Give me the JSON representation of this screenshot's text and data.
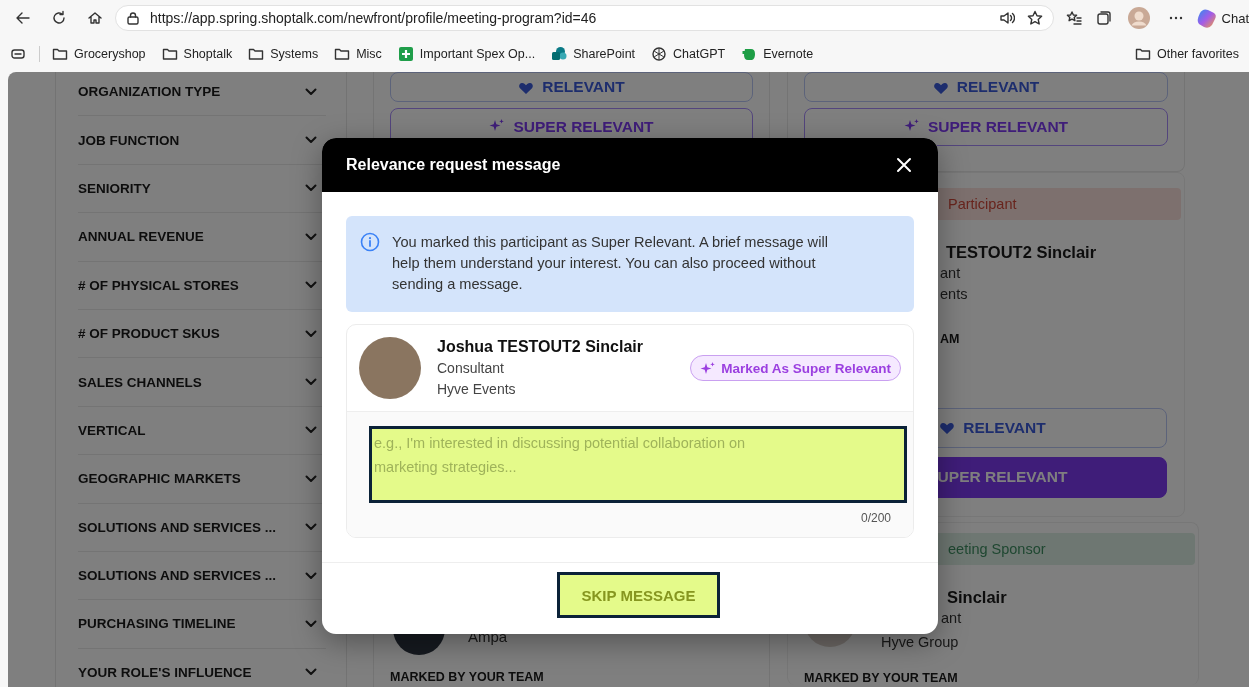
{
  "browser": {
    "url": "https://app.spring.shoptalk.com/newfront/profile/meeting-program?id=46",
    "chat_label": "Chat",
    "bookmarks": [
      {
        "label": "Groceryshop",
        "kind": "folder"
      },
      {
        "label": "Shoptalk",
        "kind": "folder"
      },
      {
        "label": "Systems",
        "kind": "folder"
      },
      {
        "label": "Misc",
        "kind": "folder"
      },
      {
        "label": "Important Spex Op...",
        "kind": "plus"
      },
      {
        "label": "SharePoint",
        "kind": "share"
      },
      {
        "label": "ChatGPT",
        "kind": "knot"
      },
      {
        "label": "Evernote",
        "kind": "note"
      }
    ],
    "other_favorites": "Other favorites"
  },
  "filters": [
    {
      "label": "ORGANIZATION TYPE"
    },
    {
      "label": "JOB FUNCTION"
    },
    {
      "label": "SENIORITY"
    },
    {
      "label": "ANNUAL REVENUE"
    },
    {
      "label": "# OF PHYSICAL STORES"
    },
    {
      "label": "# OF PRODUCT SKUS"
    },
    {
      "label": "SALES CHANNELS"
    },
    {
      "label": "VERTICAL"
    },
    {
      "label": "GEOGRAPHIC MARKETS"
    },
    {
      "label": "SOLUTIONS AND SERVICES ..."
    },
    {
      "label": "SOLUTIONS AND SERVICES ..."
    },
    {
      "label": "PURCHASING TIMELINE"
    },
    {
      "label": "YOUR ROLE'S INFLUENCE"
    }
  ],
  "middle_column": {
    "actions": [
      {
        "kind": "relevant",
        "label": "RELEVANT",
        "selected": false,
        "show_icon": true
      },
      {
        "kind": "super",
        "label": "SUPER RELEVANT",
        "selected": false,
        "show_icon": true
      }
    ],
    "company": "Ampa",
    "marked_by": "MARKED BY YOUR TEAM"
  },
  "right_column": {
    "actions": [
      {
        "kind": "relevant",
        "label": "RELEVANT",
        "selected": false,
        "show_icon": true
      },
      {
        "kind": "super",
        "label": "SUPER RELEVANT",
        "selected": false,
        "show_icon": true
      }
    ],
    "card": {
      "tag": {
        "kind": "participant",
        "label": "Participant"
      },
      "name": "TESTOUT2 Sinclair",
      "role": "ant",
      "company": "ents",
      "team_label": "AM",
      "actions": [
        {
          "kind": "relevant",
          "label": "RELEVANT",
          "selected": false,
          "show_icon": true
        },
        {
          "kind": "super",
          "label": "UPER RELEVANT",
          "selected": true,
          "show_icon": false
        }
      ]
    },
    "card2": {
      "tag": {
        "kind": "sponsor",
        "label": "eeting Sponsor"
      },
      "name": "Sinclair",
      "role": "ant",
      "company": "Hyve Group",
      "marked_by": "MARKED BY YOUR TEAM"
    }
  },
  "modal": {
    "title": "Relevance request message",
    "info": "You marked this participant as Super Relevant. A brief message will help them understand your interest. You can also proceed without sending a message.",
    "participant": {
      "name": "Joshua TESTOUT2 Sinclair",
      "role": "Consultant",
      "company": "Hyve Events",
      "badge": "Marked As Super Relevant"
    },
    "message": {
      "placeholder": "e.g., I'm interested in discussing potential collaboration on marketing strategies...",
      "counter": "0/200"
    },
    "skip_button": "SKIP MESSAGE"
  }
}
